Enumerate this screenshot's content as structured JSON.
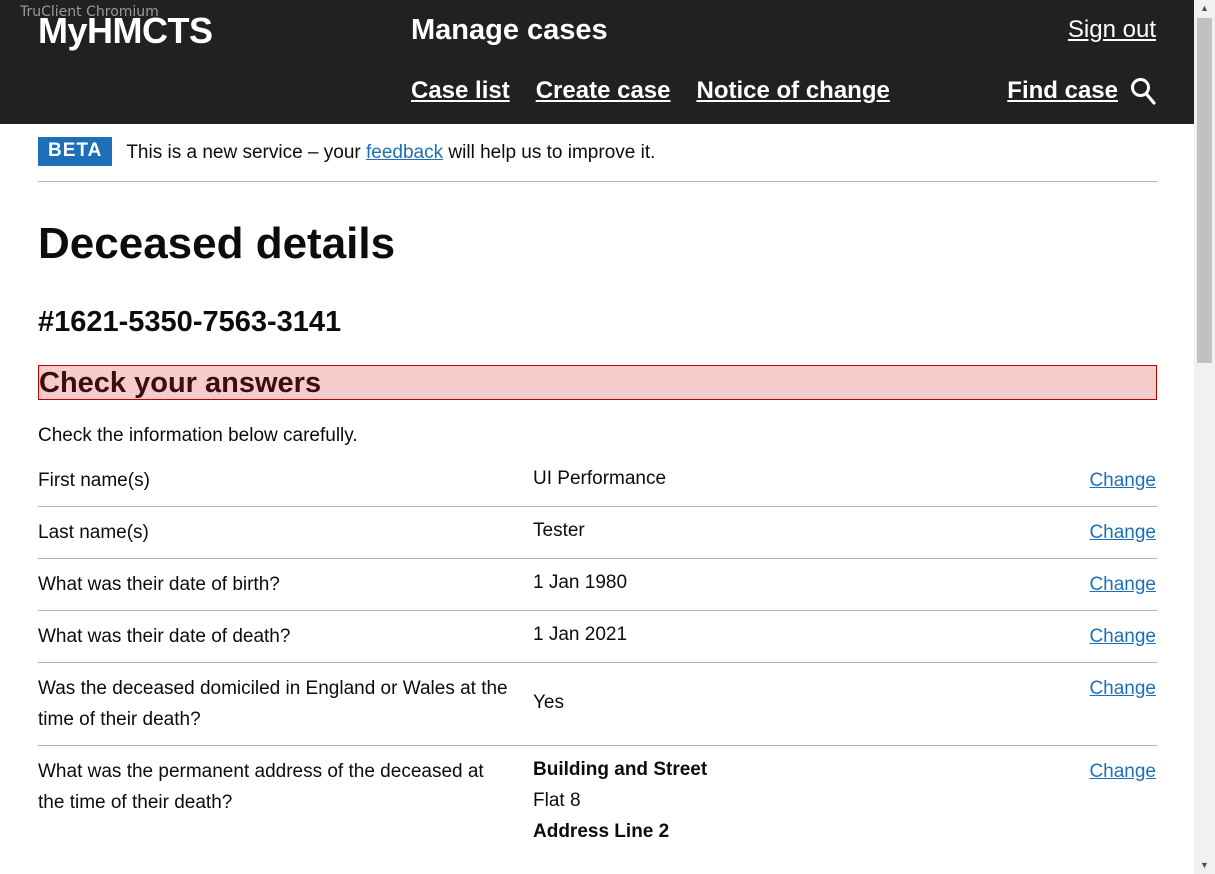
{
  "window": {
    "title": "TruClient Chromium"
  },
  "header": {
    "logo": "MyHMCTS",
    "service_name": "Manage cases",
    "sign_out": "Sign out",
    "nav": [
      "Case list",
      "Create case",
      "Notice of change"
    ],
    "find_case": "Find case",
    "find_case_icon": "search-icon",
    "background": "#212121"
  },
  "beta": {
    "tag": "BETA",
    "text_before": "This is a new service – your ",
    "link": "feedback",
    "text_after": " will help us to improve it.",
    "tag_color": "#1d70b8"
  },
  "page": {
    "title": "Deceased details",
    "case_reference": "#1621-5350-7563-3141",
    "check_heading": "Check your answers",
    "intro": "Check the information below carefully."
  },
  "summary": {
    "change_label": "Change",
    "rows": [
      {
        "key": "First name(s)",
        "value": "UI Performance"
      },
      {
        "key": "Last name(s)",
        "value": "Tester"
      },
      {
        "key": "What was their date of birth?",
        "value": "1 Jan 1980"
      },
      {
        "key": "What was their date of death?",
        "value": "1 Jan 2021"
      },
      {
        "key": "Was the deceased domiciled in England or Wales at the time of their death?",
        "value": "Yes"
      }
    ],
    "address_row": {
      "key": "What was the permanent address of the deceased at the time of their death?",
      "building_label": "Building and Street",
      "building_value": "Flat 8",
      "line2_label": "Address Line 2"
    }
  },
  "colors": {
    "link": "#1d70b8",
    "error_heading_bg": "#f4cccc",
    "error_heading_border": "#c00000"
  }
}
